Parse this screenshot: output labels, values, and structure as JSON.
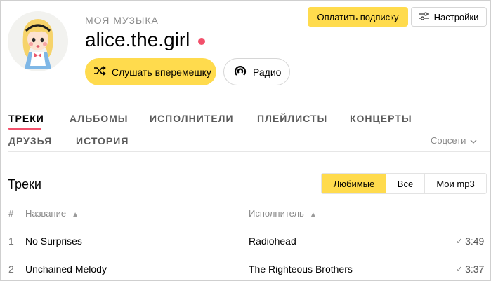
{
  "header": {
    "section_label": "МОЯ МУЗЫКА",
    "username": "alice.the.girl",
    "shuffle_label": "Слушать вперемешку",
    "radio_label": "Радио",
    "pay_label": "Оплатить подписку",
    "settings_label": "Настройки"
  },
  "tabs": [
    {
      "label": "ТРЕКИ",
      "active": true
    },
    {
      "label": "АЛЬБОМЫ",
      "active": false
    },
    {
      "label": "ИСПОЛНИТЕЛИ",
      "active": false
    },
    {
      "label": "ПЛЕЙЛИСТЫ",
      "active": false
    },
    {
      "label": "КОНЦЕРТЫ",
      "active": false
    },
    {
      "label": "ДРУЗЬЯ",
      "active": false
    },
    {
      "label": "ИСТОРИЯ",
      "active": false
    }
  ],
  "social_dropdown": "Соцсети",
  "tracks": {
    "title": "Треки",
    "filters": [
      "Любимые",
      "Все",
      "Мои mp3"
    ],
    "active_filter": "Любимые",
    "columns": {
      "num": "#",
      "title": "Название",
      "artist": "Исполнитель"
    },
    "rows": [
      {
        "num": "1",
        "title": "No Surprises",
        "artist": "Radiohead",
        "duration": "3:49"
      },
      {
        "num": "2",
        "title": "Unchained Melody",
        "artist": "The Righteous Brothers",
        "duration": "3:37"
      }
    ]
  },
  "colors": {
    "accent_yellow": "#ffdb4d",
    "accent_red": "#f2506b"
  }
}
